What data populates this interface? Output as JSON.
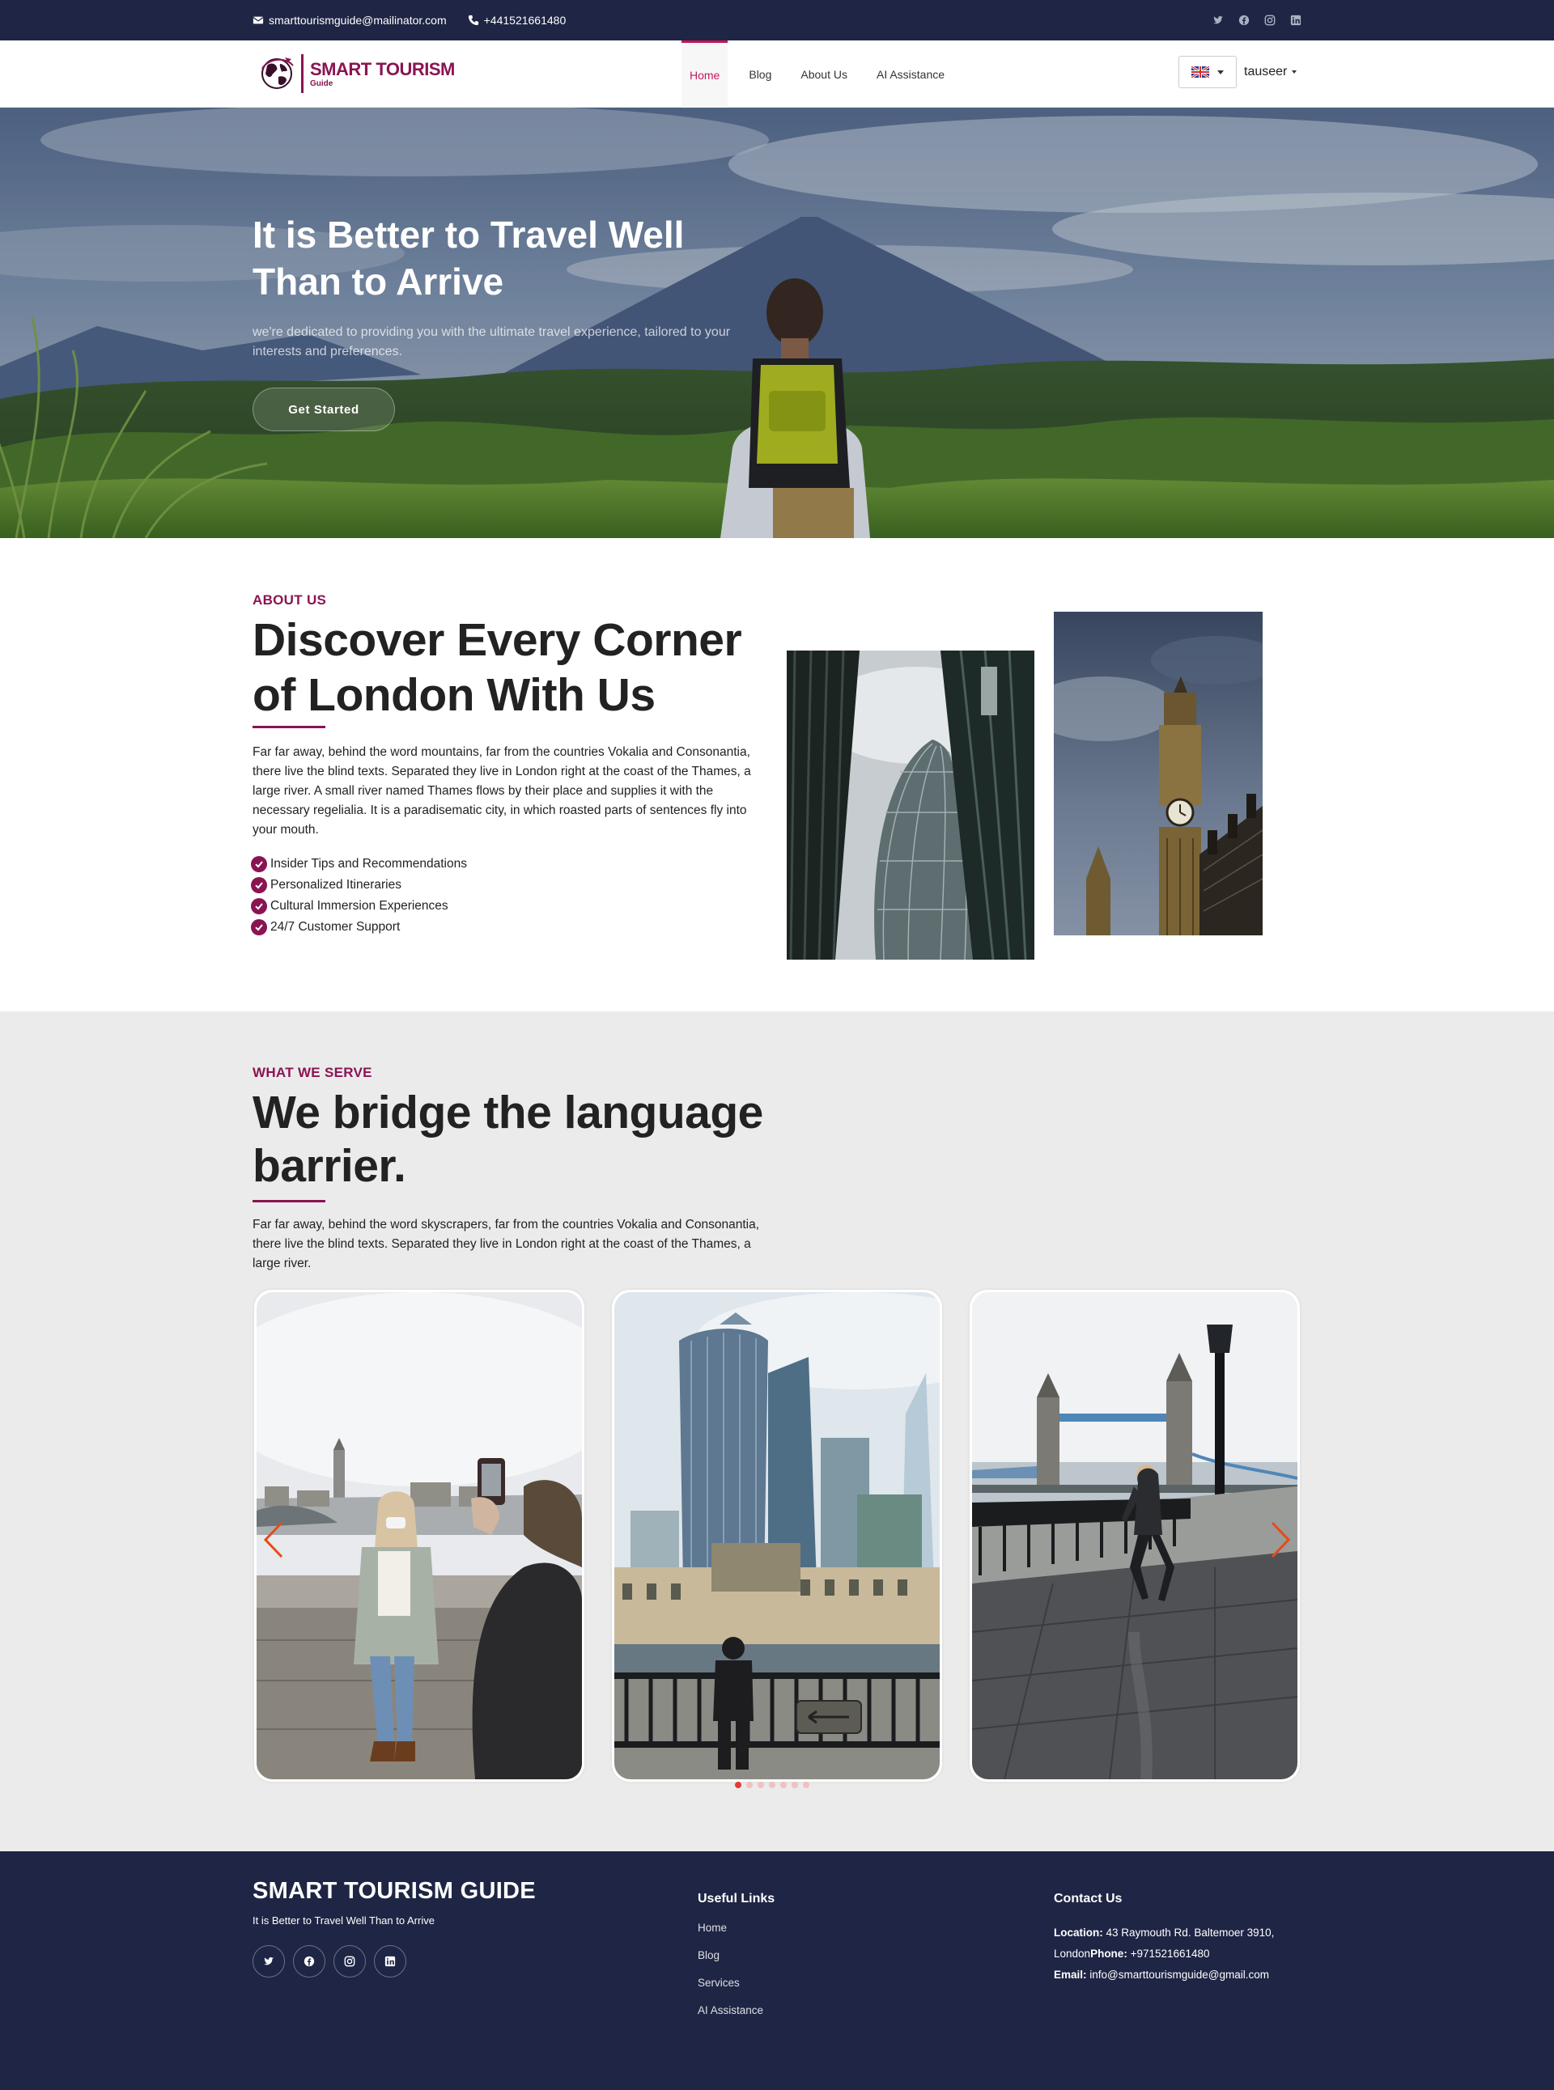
{
  "topbar": {
    "email": "smarttourismguide@mailinator.com",
    "phone": "+441521661480"
  },
  "brand": {
    "name": "SMART TOURISM",
    "sub": "Guide"
  },
  "nav": {
    "items": [
      {
        "label": "Home",
        "active": true
      },
      {
        "label": "Blog"
      },
      {
        "label": "About Us"
      },
      {
        "label": "AI Assistance"
      }
    ],
    "user": "tauseer"
  },
  "hero": {
    "title": "It is Better to Travel Well Than to Arrive",
    "subtitle": "we're dedicated to providing you with the ultimate travel experience, tailored to your interests and preferences.",
    "cta": "Get Started"
  },
  "about": {
    "kicker": "ABOUT US",
    "title": "Discover Every Corner of London With Us",
    "description": "Far far away, behind the word mountains, far from the countries Vokalia and Consonantia, there live the blind texts. Separated they live in London right at the coast of the Thames, a large river. A small river named Thames flows by their place and supplies it with the necessary regelialia. It is a paradisematic city, in which roasted parts of sentences fly into your mouth.",
    "features": [
      "Insider Tips and Recommendations",
      "Personalized Itineraries",
      "Cultural Immersion Experiences",
      "24/7 Customer Support"
    ]
  },
  "serve": {
    "kicker": "WHAT WE SERVE",
    "title": "We bridge the language barrier.",
    "description": "Far far away, behind the word skyscrapers, far from the countries Vokalia and Consonantia, there live the blind texts. Separated they live in London right at the coast of the Thames, a large river.",
    "carousel": {
      "slides": 7,
      "active": 1
    }
  },
  "footer": {
    "title": "SMART TOURISM GUIDE",
    "tagline": "It is Better to Travel Well Than to Arrive",
    "links_title": "Useful Links",
    "links": [
      "Home",
      "Blog",
      "Services",
      "AI Assistance"
    ],
    "contact_title": "Contact Us",
    "location_label": "Location:",
    "location": "43 Raymouth Rd. Baltemoer 3910, London",
    "phone_label": "Phone:",
    "phone": "+971521661480",
    "email_label": "Email:",
    "email": "info@smarttourismguide@gmail.com"
  },
  "colors": {
    "navy": "#1f2544",
    "accent": "#8a1452",
    "nav_active": "#c2185b",
    "carousel_dot": "#e53935"
  }
}
